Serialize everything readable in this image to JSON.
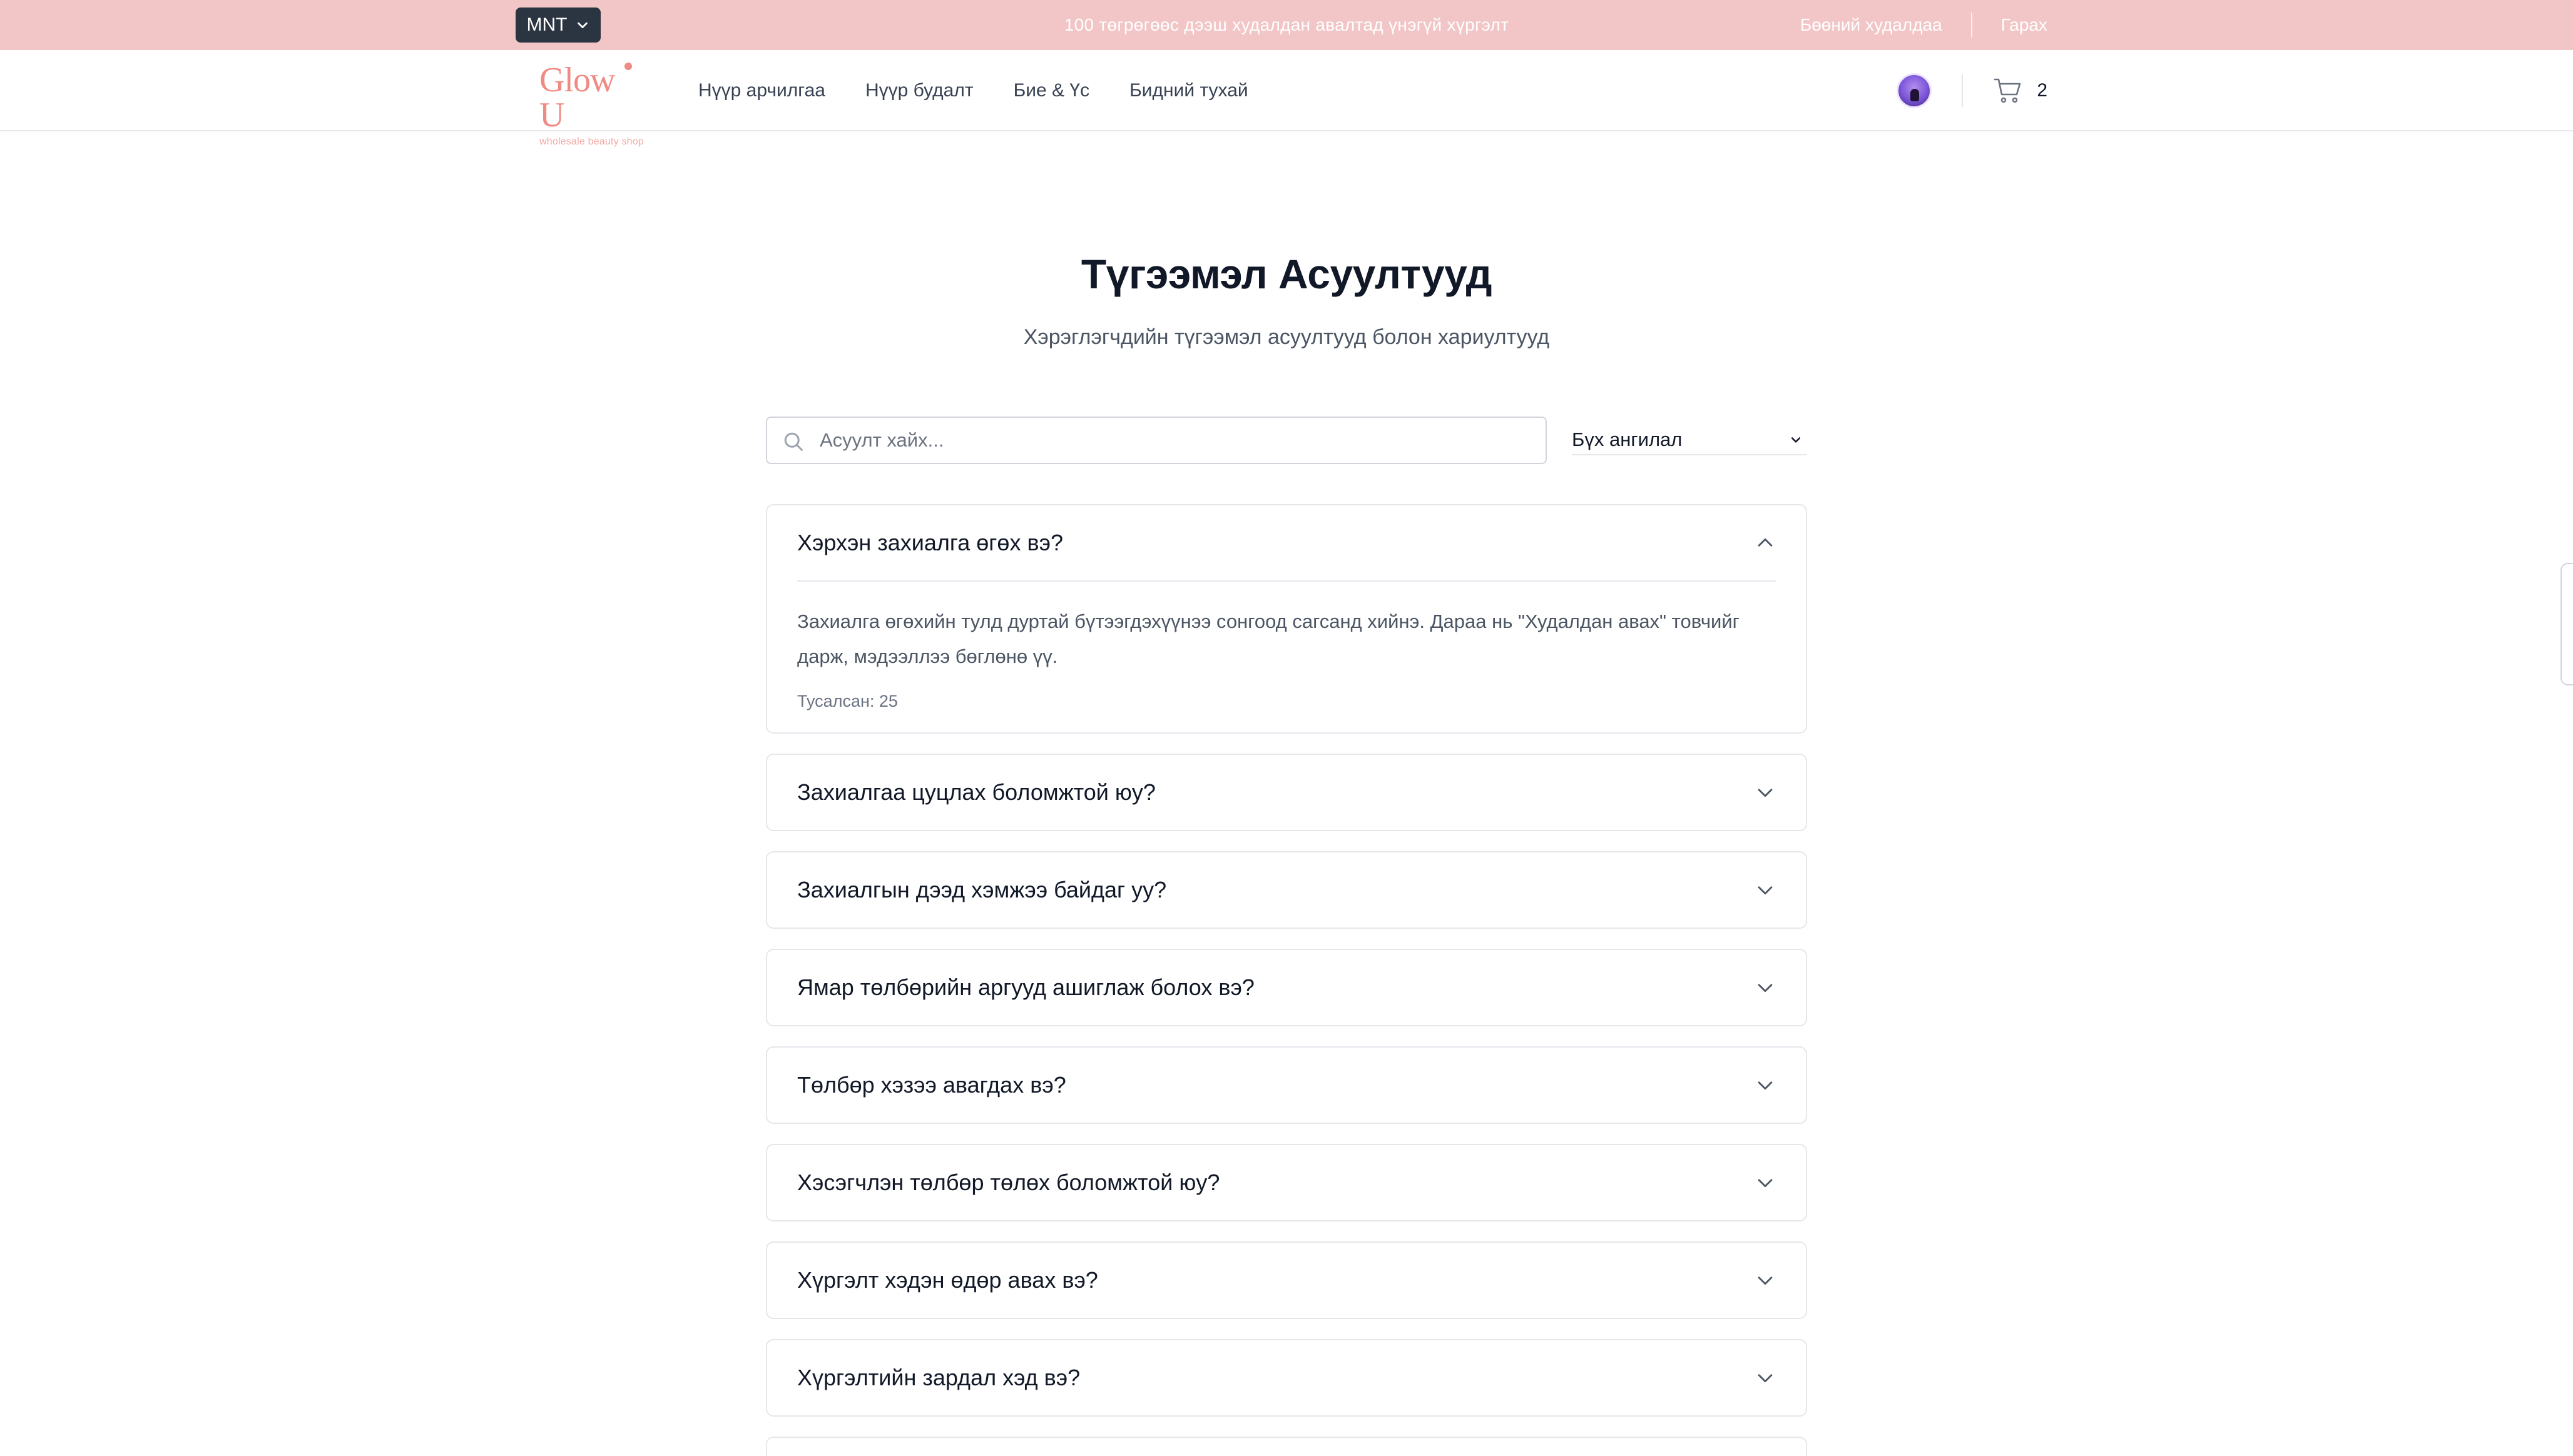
{
  "topbar": {
    "currency": "MNT",
    "announcement": "100 төгрөгөөс дээш худалдан авалтад үнэгүй хүргэлт",
    "links": [
      "Бөөний худалдаа",
      "Гарах"
    ]
  },
  "header": {
    "logo": {
      "name": "Glow U",
      "tagline": "wholesale beauty shop"
    },
    "nav": [
      "Нүүр арчилгаа",
      "Нүүр будалт",
      "Бие & Үс",
      "Бидний тухай"
    ],
    "cart_count": "2"
  },
  "main": {
    "title": "Түгээмэл Асуултууд",
    "subtitle": "Хэрэглэгчдийн түгээмэл асуултууд болон хариултууд",
    "search": {
      "placeholder": "Асуулт хайх...",
      "value": ""
    },
    "category": {
      "selected": "Бүх ангилал"
    },
    "faqs": [
      {
        "question": "Хэрхэн захиалга өгөх вэ?",
        "answer": "Захиалга өгөхийн тулд дуртай бүтээгдэхүүнээ сонгоод сагсанд хийнэ. Дараа нь \"Худалдан авах\" товчийг дарж, мэдээллээ бөглөнө үү.",
        "helpful": "Тусалсан: 25"
      },
      {
        "question": "Захиалгаа цуцлах боломжтой юу?"
      },
      {
        "question": "Захиалгын дээд хэмжээ байдаг уу?"
      },
      {
        "question": "Ямар төлбөрийн аргууд ашиглаж болох вэ?"
      },
      {
        "question": "Төлбөр хэзээ авагдах вэ?"
      },
      {
        "question": "Хэсэгчлэн төлбөр төлөх боломжтой юу?"
      },
      {
        "question": "Хүргэлт хэдэн өдөр авах вэ?"
      },
      {
        "question": "Хүргэлтийн зардал хэд вэ?"
      }
    ]
  },
  "colors": {
    "topbar_bg": "#f2c6c7",
    "logo": "#ef8b84",
    "currency_bg": "#2b3441"
  }
}
